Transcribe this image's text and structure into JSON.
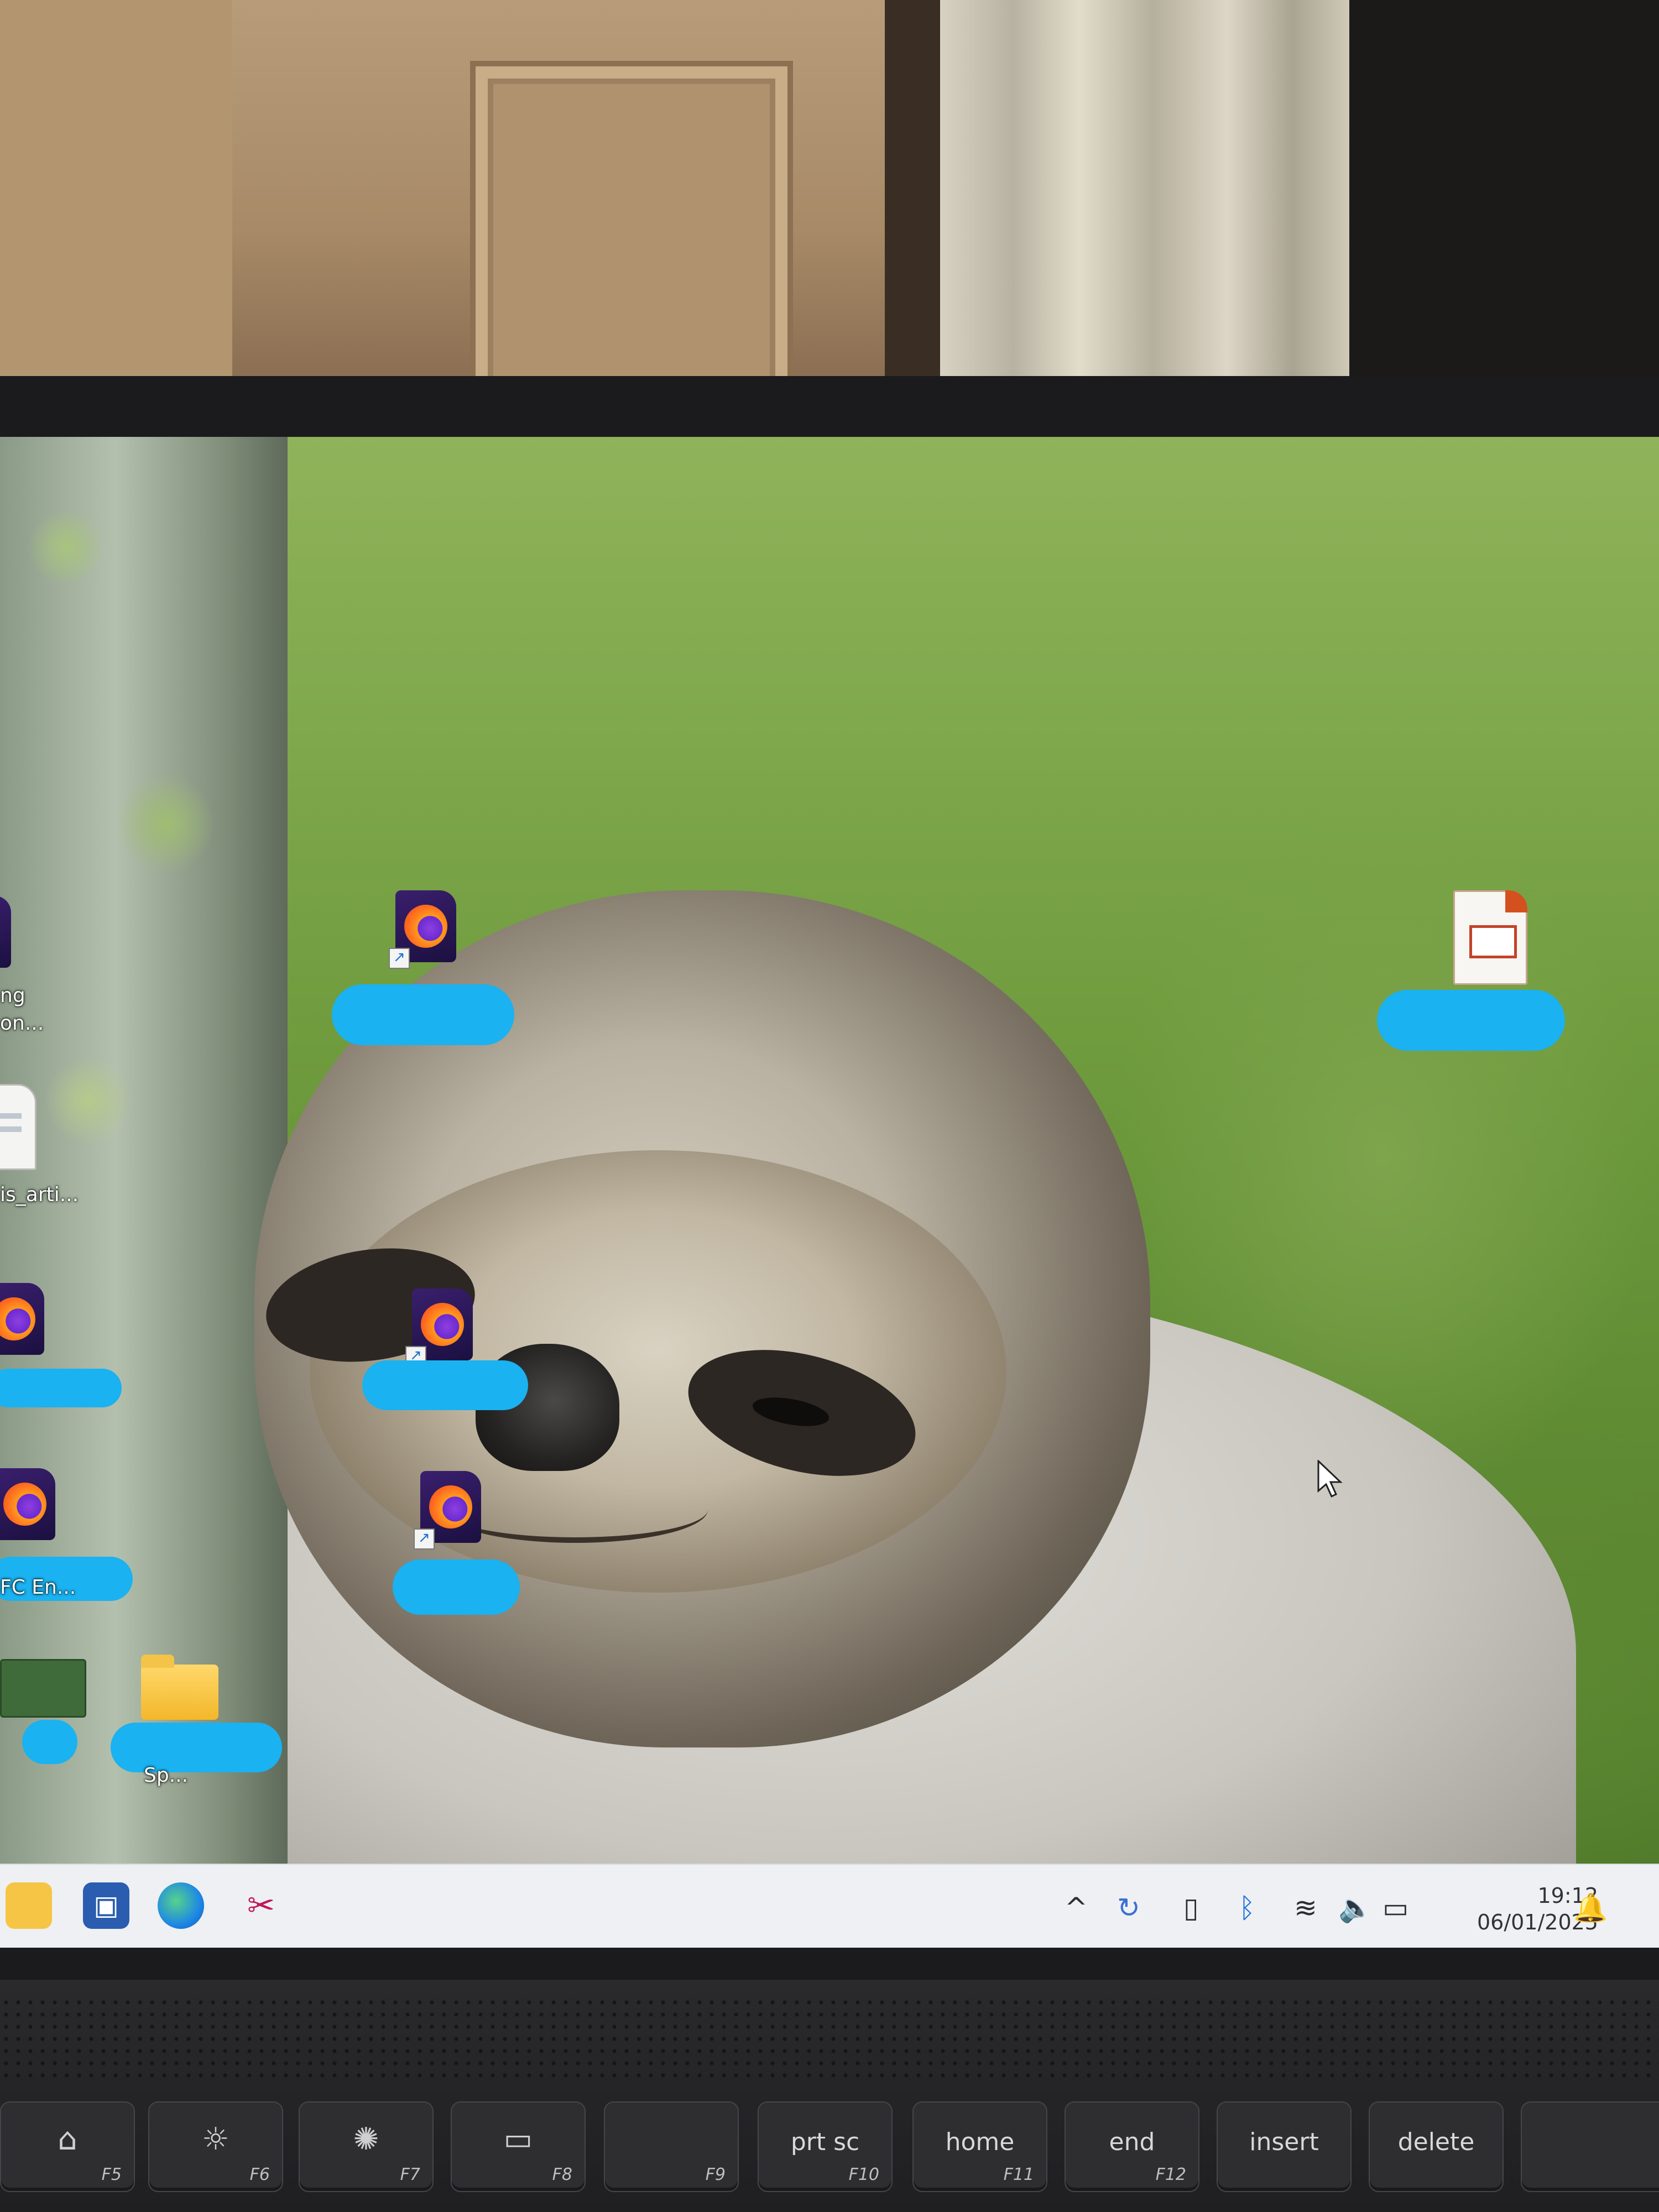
{
  "desktop": {
    "partial_labels": {
      "icon_top_left_line1": "ng",
      "icon_top_left_line2": "on...",
      "icon_article": "is_arti...",
      "icon_pfc": "FC En...",
      "icon_folder": "Sp..."
    },
    "cursor": "arrow-cursor"
  },
  "taskbar": {
    "icons": [
      "file-explorer-icon",
      "app-icon",
      "edge-icon",
      "snipping-tool-icon"
    ],
    "tray": {
      "chevron": "^",
      "time": "19:12",
      "date": "06/01/2025"
    }
  },
  "keyboard": {
    "keys": [
      {
        "sub": "F5",
        "glyph": "⌂"
      },
      {
        "sub": "F6",
        "glyph": "☼"
      },
      {
        "sub": "F7",
        "glyph": "✺"
      },
      {
        "sub": "F8",
        "glyph": "▭"
      },
      {
        "sub": "F9",
        "glyph": ""
      },
      {
        "main": "prt sc",
        "sub": "F10"
      },
      {
        "main": "home",
        "sub": "F11"
      },
      {
        "main": "end",
        "sub": "F12"
      },
      {
        "main": "insert"
      },
      {
        "main": "delete"
      }
    ]
  },
  "colors": {
    "redaction": "#1ab2f0",
    "taskbar_bg": "#eef0f3"
  }
}
